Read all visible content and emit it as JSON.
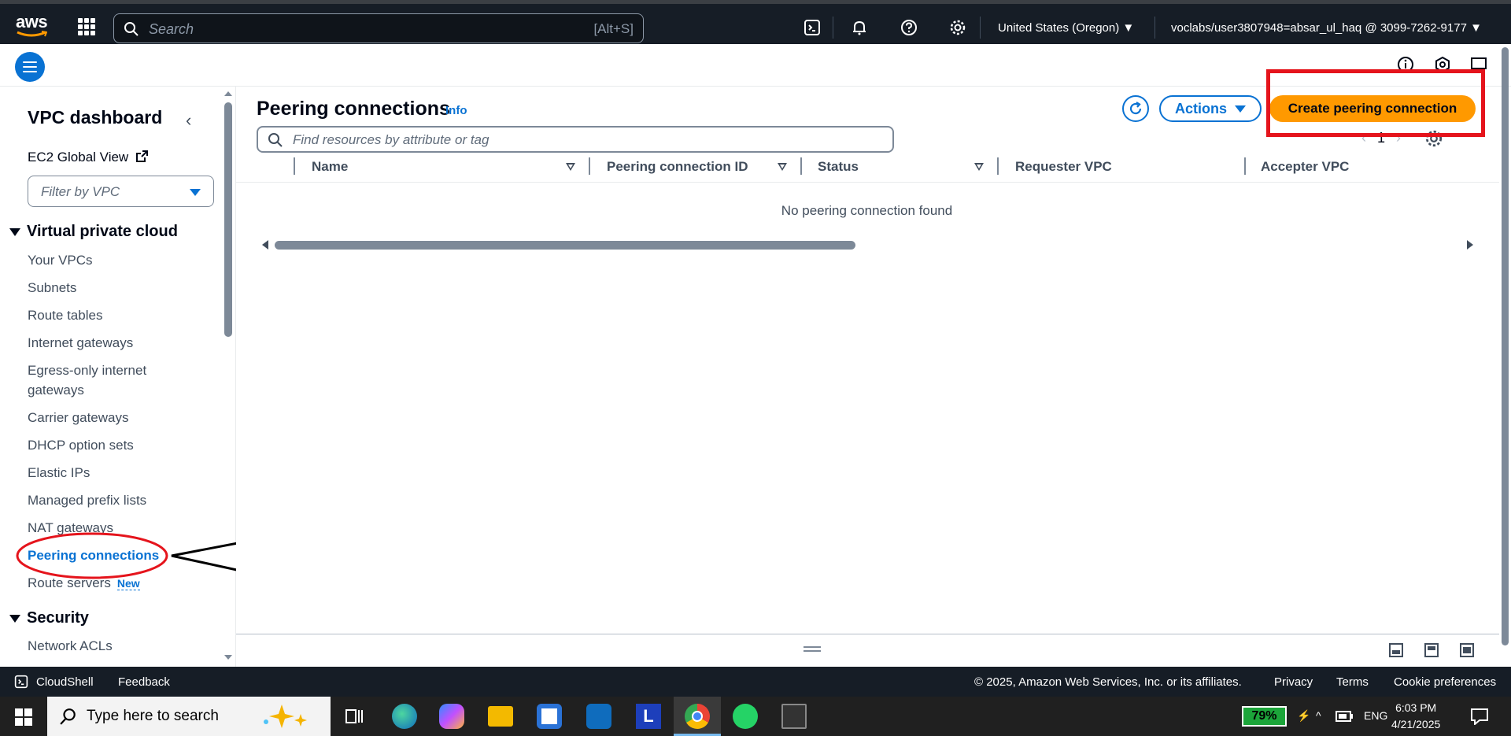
{
  "topbar": {
    "logo_text": "aws",
    "search_placeholder": "Search",
    "search_shortcut": "[Alt+S]",
    "region": "United States (Oregon)",
    "account": "voclabs/user3807948=absar_ul_haq @ 3099-7262-9177"
  },
  "sidebar": {
    "title": "VPC dashboard",
    "ec2_global_view": "EC2 Global View",
    "filter_placeholder": "Filter by VPC",
    "section_vpc": "Virtual private cloud",
    "items": [
      {
        "label": "Your VPCs"
      },
      {
        "label": "Subnets"
      },
      {
        "label": "Route tables"
      },
      {
        "label": "Internet gateways"
      },
      {
        "label": "Egress-only internet gateways"
      },
      {
        "label": "Carrier gateways"
      },
      {
        "label": "DHCP option sets"
      },
      {
        "label": "Elastic IPs"
      },
      {
        "label": "Managed prefix lists"
      },
      {
        "label": "NAT gateways"
      },
      {
        "label": "Peering connections"
      },
      {
        "label": "Route servers"
      }
    ],
    "new_badge": "New",
    "section_security": "Security",
    "security_items": [
      {
        "label": "Network ACLs"
      }
    ]
  },
  "main": {
    "title": "Peering connections",
    "info": "Info",
    "actions_label": "Actions",
    "create_label": "Create peering connection",
    "table_search_placeholder": "Find resources by attribute or tag",
    "page_number": "1",
    "columns": [
      "Name",
      "Peering connection ID",
      "Status",
      "Requester VPC",
      "Accepter VPC"
    ],
    "empty_message": "No peering connection found"
  },
  "footer": {
    "cloudshell": "CloudShell",
    "feedback": "Feedback",
    "copyright": "© 2025, Amazon Web Services, Inc. or its affiliates.",
    "privacy": "Privacy",
    "terms": "Terms",
    "cookies": "Cookie preferences"
  },
  "taskbar": {
    "search_placeholder": "Type here to search",
    "battery": "79%",
    "language": "ENG",
    "time": "6:03 PM",
    "date": "4/21/2025"
  },
  "colors": {
    "accent": "#0972d3",
    "primary_button": "#ff9900",
    "annotation_red": "#e5141c",
    "topbar_bg": "#161d26"
  }
}
